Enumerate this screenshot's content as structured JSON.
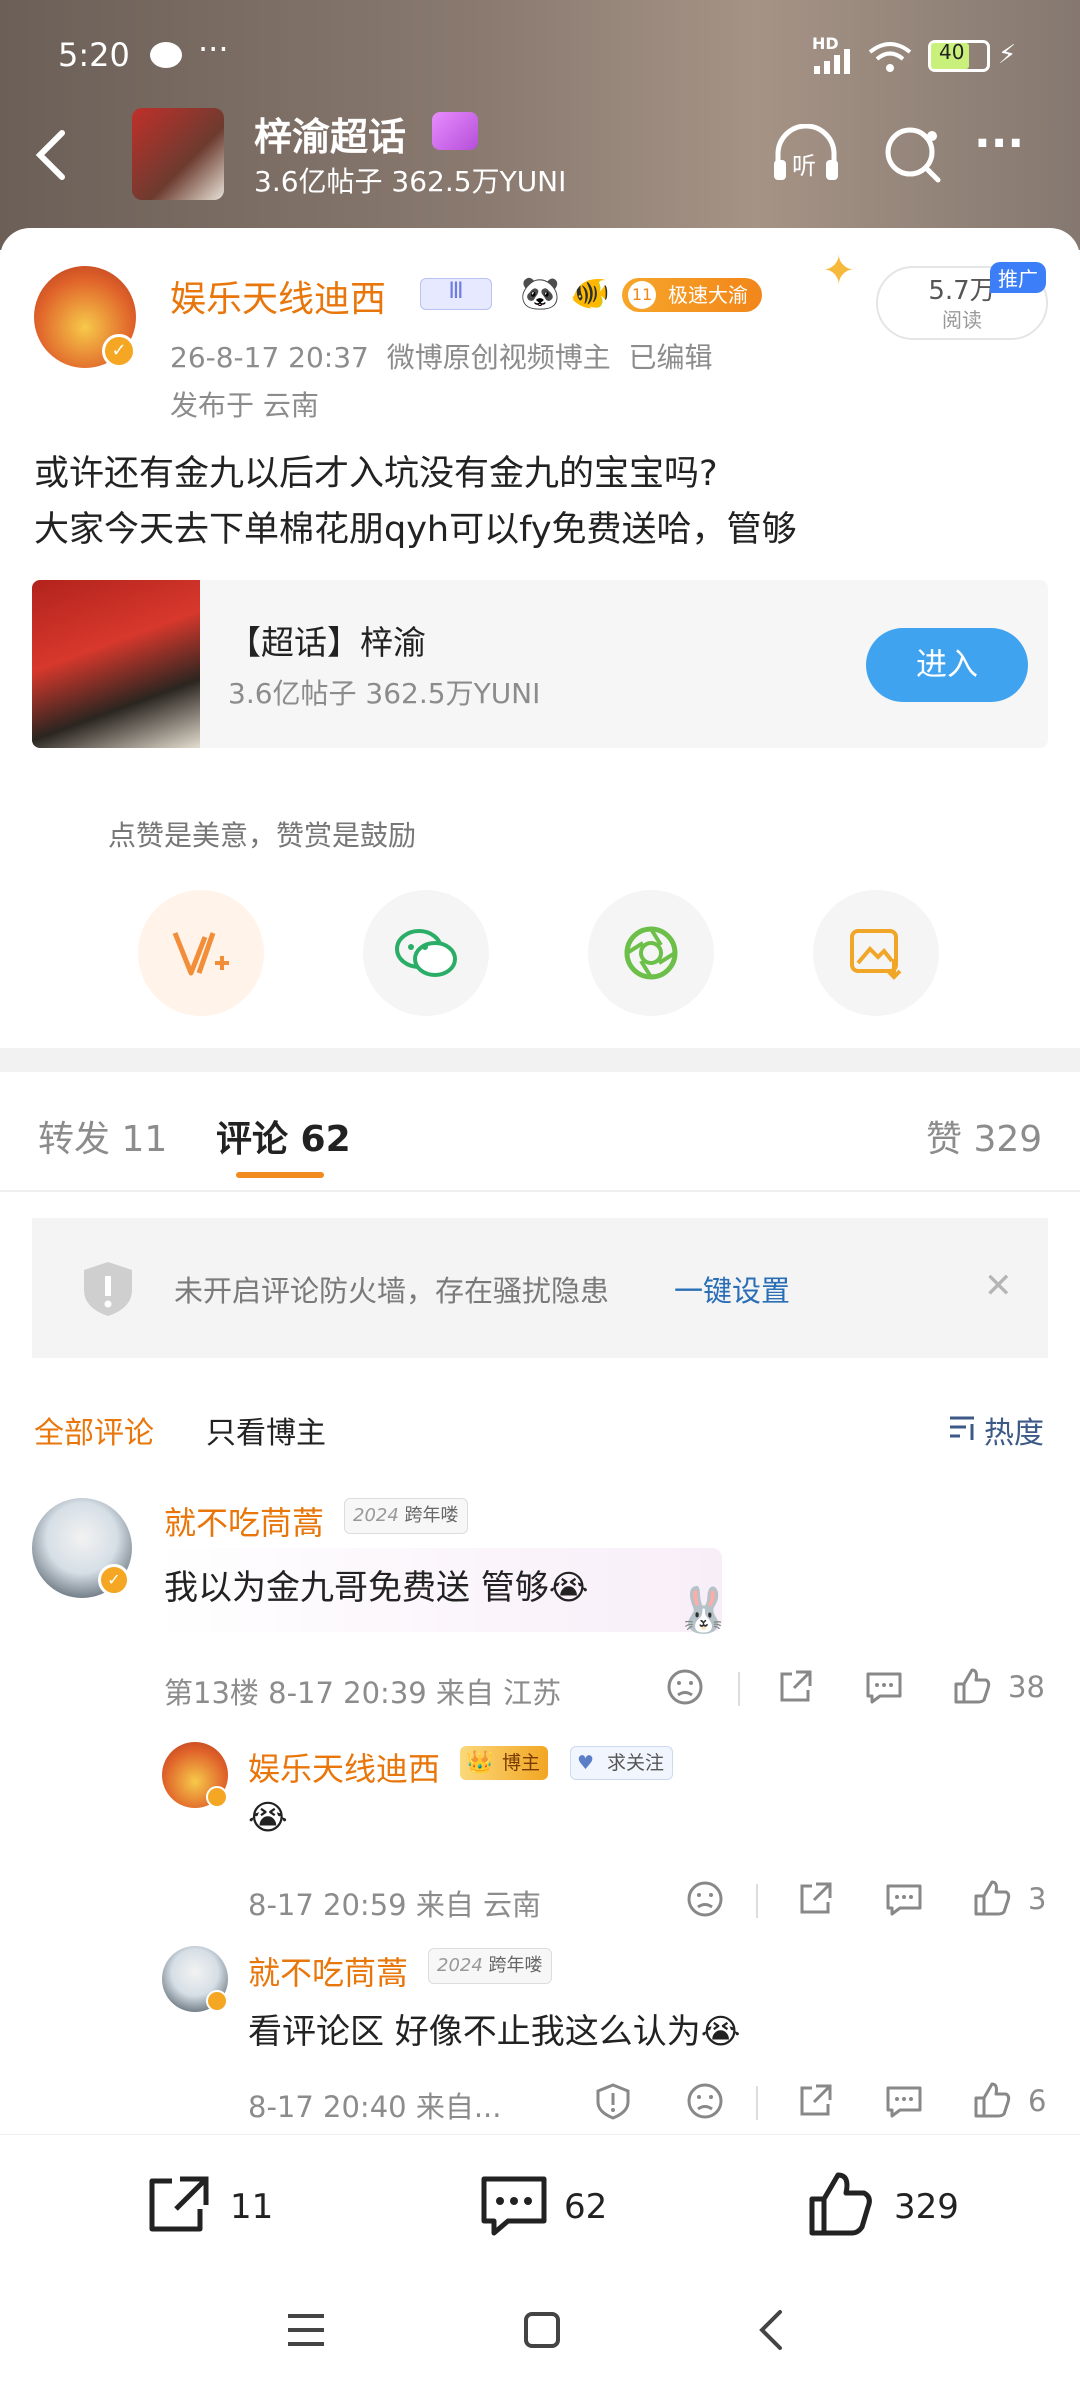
{
  "status_bar": {
    "time": "5:20",
    "battery": "40",
    "network": "HD"
  },
  "topic_header": {
    "title": "梓渝超话",
    "stats": "3.6亿帖子 362.5万YUNI"
  },
  "post": {
    "author": "娱乐天线迪西",
    "date": "26-8-17 20:37",
    "source": "微博原创视频博主",
    "edited": "已编辑",
    "location": "发布于 云南",
    "badge_level": "Ⅲ",
    "badge_fan": "极速大渝",
    "badge_fan_level": "11",
    "read_count": "5.7万",
    "read_label": "阅读",
    "promo_tag": "推广",
    "text_line1": "或许还有金九以后才入坑没有金九的宝宝吗?",
    "text_line2": "大家今天去下单棉花朋qyh可以fy免费送哈，管够"
  },
  "supertopic_card": {
    "title": "【超话】梓渝",
    "stats": "3.6亿帖子 362.5万YUNI",
    "enter_button": "进入"
  },
  "reward": {
    "hint": "点赞是美意，赞赏是鼓励"
  },
  "tabs": {
    "repost": "转发 11",
    "comment": "评论 62",
    "like": "赞 329"
  },
  "firewall": {
    "text": "未开启评论防火墙，存在骚扰隐患",
    "action": "一键设置"
  },
  "filter": {
    "all": "全部评论",
    "author_only": "只看博主",
    "sort": "热度"
  },
  "comments": [
    {
      "user": "就不吃茼蒿",
      "badge": "跨年喽",
      "badge_year": "2024",
      "text": "我以为金九哥免费送 管够😭",
      "meta": "第13楼 8-17 20:39 来自 江苏",
      "likes": "38"
    }
  ],
  "replies": [
    {
      "user": "娱乐天线迪西",
      "role": "博主",
      "follow": "求关注",
      "text": "😭",
      "meta": "8-17 20:59 来自 云南",
      "likes": "3"
    },
    {
      "user": "就不吃茼蒿",
      "badge": "跨年喽",
      "badge_year": "2024",
      "text": "看评论区 好像不止我这么认为😭",
      "meta": "8-17 20:40 来自...",
      "likes": "6"
    }
  ],
  "bottom_bar": {
    "repost_count": "11",
    "comment_count": "62",
    "like_count": "329"
  },
  "colors": {
    "accent": "#e8760a",
    "link": "#2a6fb5",
    "button": "#3fa3f0"
  }
}
